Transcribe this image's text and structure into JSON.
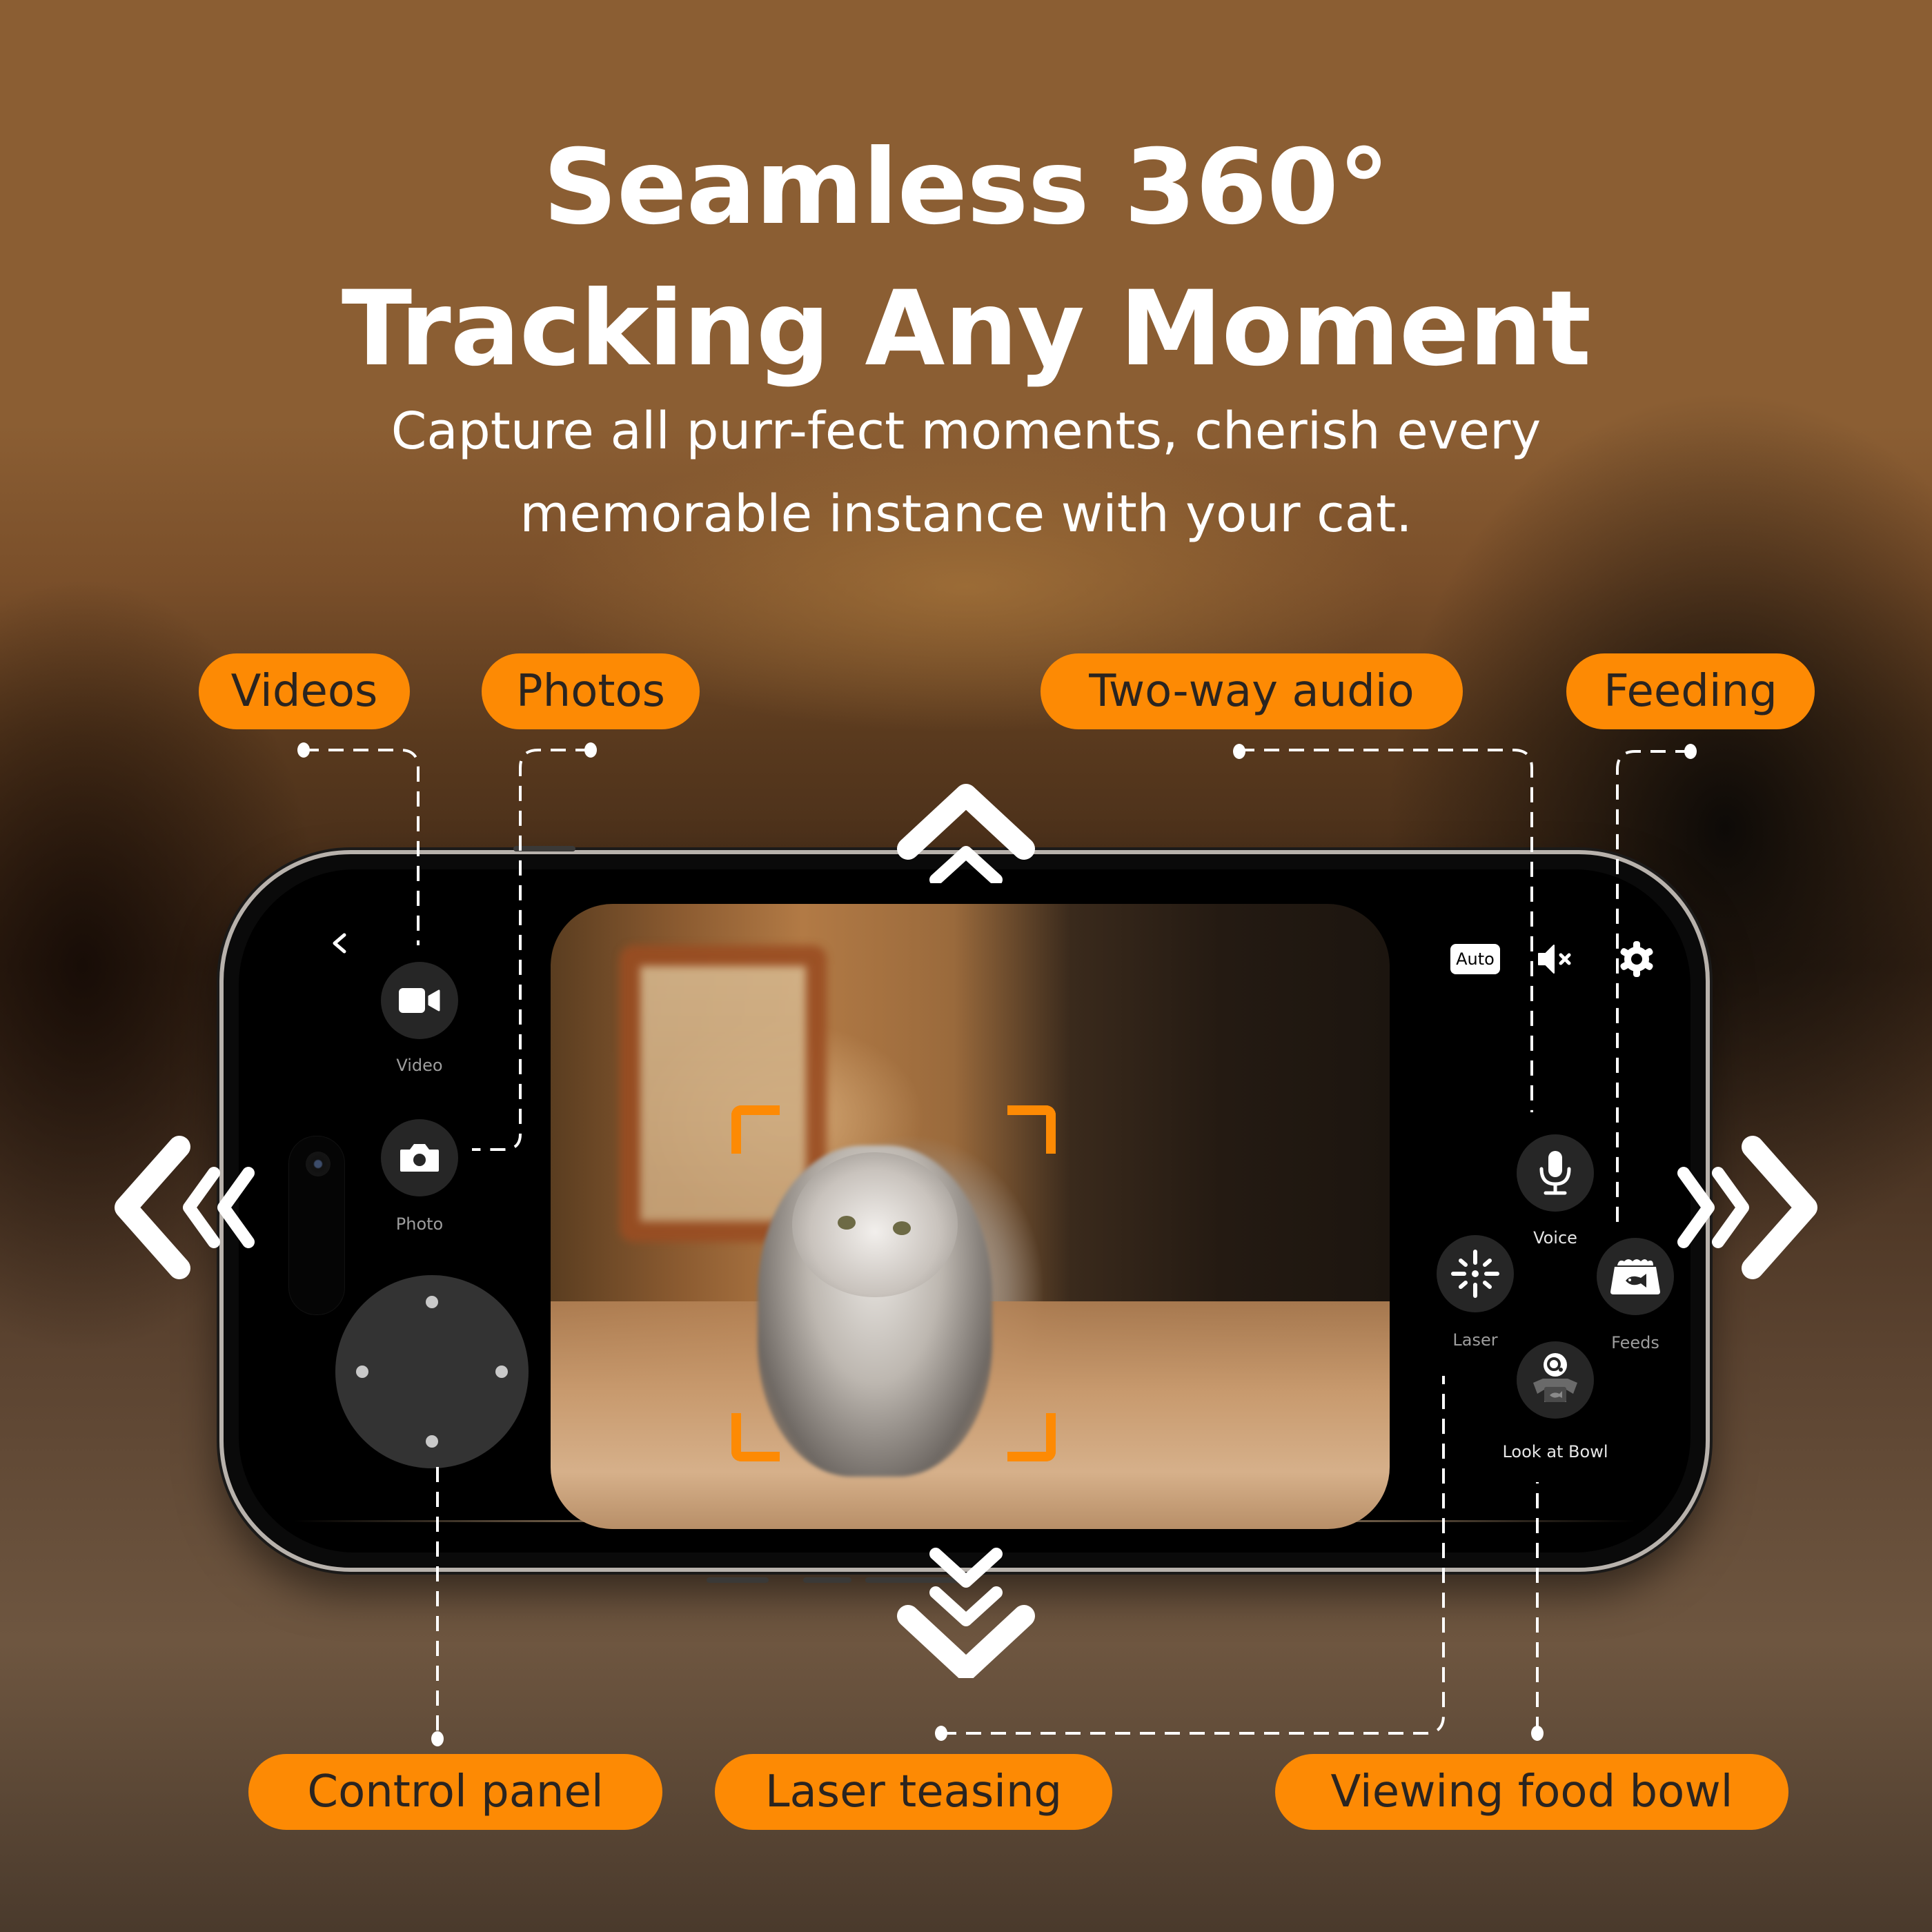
{
  "headline": {
    "line1": "Seamless 360°",
    "line2": "Tracking Any Moment"
  },
  "subheadline": {
    "line1": "Capture all purr-fect moments, cherish every",
    "line2": "memorable instance with your cat."
  },
  "callouts": {
    "videos": "Videos",
    "photos": "Photos",
    "two_way_audio": "Two-way audio",
    "feeding": "Feeding",
    "control_panel": "Control panel",
    "laser_teasing": "Laser teasing",
    "viewing_food_bowl": "Viewing food bowl"
  },
  "app": {
    "back_icon": "chevron-left-icon",
    "left_controls": [
      {
        "label": "Video",
        "icon": "video-camera-icon"
      },
      {
        "label": "Photo",
        "icon": "camera-icon"
      }
    ],
    "joystick_icon": "directional-pad",
    "top_right": {
      "mode_badge": "Auto",
      "mute_icon": "speaker-muted-icon",
      "settings_icon": "gear-icon"
    },
    "right_controls": [
      {
        "label": "Voice",
        "icon": "microphone-icon"
      },
      {
        "label": "Laser",
        "icon": "laser-burst-icon"
      },
      {
        "label": "Feeds",
        "icon": "food-bowl-icon"
      },
      {
        "label": "Look at Bowl",
        "icon": "camera-bowl-icon"
      }
    ],
    "tracking_frame_color": "#fd8a04"
  },
  "pan_arrows": [
    "up",
    "down",
    "left",
    "right"
  ],
  "colors": {
    "accent": "#fd8a04",
    "pill_text": "#2a2420",
    "background": "#8b5e33"
  }
}
